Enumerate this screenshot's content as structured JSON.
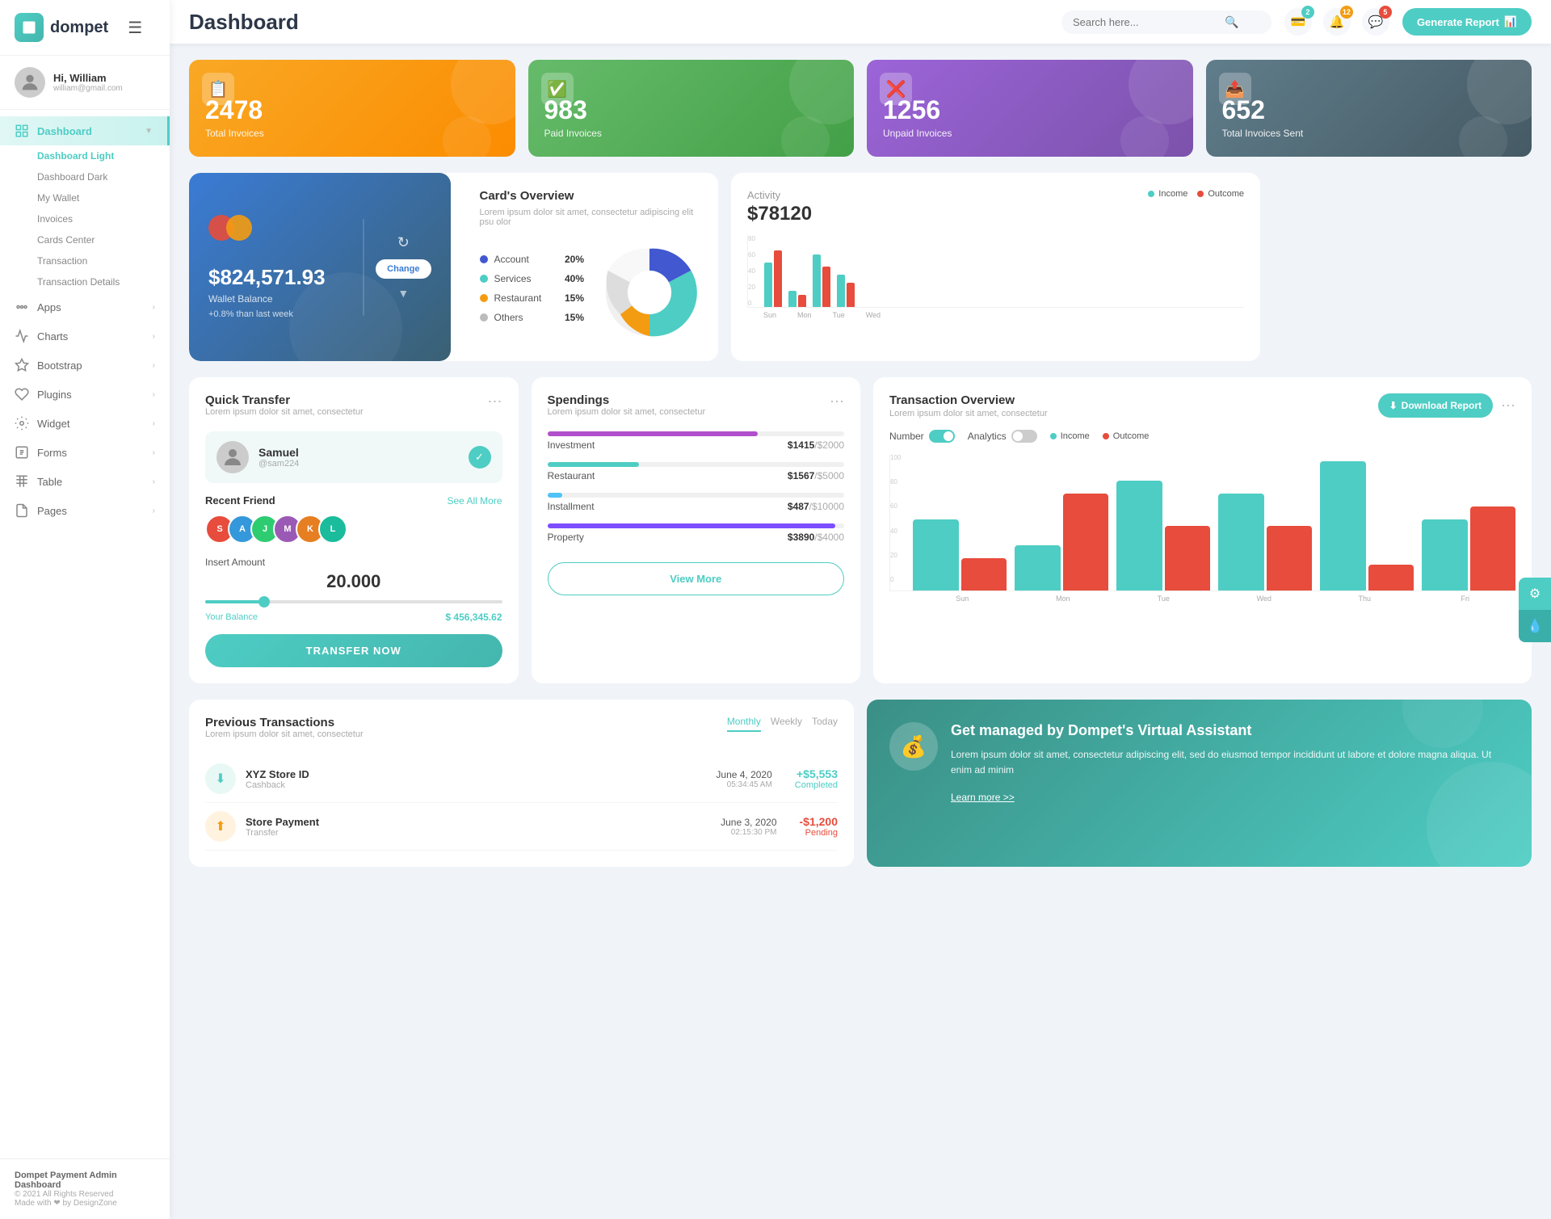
{
  "app": {
    "logo_text": "dompet",
    "page_title": "Dashboard",
    "footer_brand": "Dompet Payment Admin Dashboard",
    "footer_copy": "© 2021 All Rights Reserved",
    "footer_made": "Made with ❤ by DesignZone"
  },
  "topbar": {
    "search_placeholder": "Search here...",
    "badge_wallet": "2",
    "badge_bell": "12",
    "badge_chat": "5",
    "generate_btn": "Generate Report"
  },
  "user": {
    "greeting": "Hi, William",
    "email": "william@gmail.com"
  },
  "nav": {
    "main_item": "Dashboard",
    "sub_items": [
      "Dashboard Light",
      "Dashboard Dark",
      "My Wallet",
      "Invoices",
      "Cards Center",
      "Transaction",
      "Transaction Details"
    ],
    "section_items": [
      {
        "label": "Apps",
        "has_arrow": true
      },
      {
        "label": "Charts",
        "has_arrow": true
      },
      {
        "label": "Bootstrap",
        "has_arrow": true
      },
      {
        "label": "Plugins",
        "has_arrow": true
      },
      {
        "label": "Widget",
        "has_arrow": true
      },
      {
        "label": "Forms",
        "has_arrow": true
      },
      {
        "label": "Table",
        "has_arrow": true
      },
      {
        "label": "Pages",
        "has_arrow": true
      }
    ]
  },
  "stat_cards": [
    {
      "number": "2478",
      "label": "Total Invoices",
      "color": "orange"
    },
    {
      "number": "983",
      "label": "Paid Invoices",
      "color": "green"
    },
    {
      "number": "1256",
      "label": "Unpaid Invoices",
      "color": "purple"
    },
    {
      "number": "652",
      "label": "Total Invoices Sent",
      "color": "blue-gray"
    }
  ],
  "wallet": {
    "amount": "$824,571.93",
    "label": "Wallet Balance",
    "change": "+0.8% than last week",
    "change_btn": "Change"
  },
  "cards_overview": {
    "title": "Card's Overview",
    "description": "Lorem ipsum dolor sit amet, consectetur adipiscing elit psu olor",
    "items": [
      {
        "label": "Account",
        "pct": "20%",
        "color": "#4158d0"
      },
      {
        "label": "Services",
        "pct": "40%",
        "color": "#4ecdc4"
      },
      {
        "label": "Restaurant",
        "pct": "15%",
        "color": "#f39c12"
      },
      {
        "label": "Others",
        "pct": "15%",
        "color": "#bbb"
      }
    ]
  },
  "activity": {
    "title": "Activity",
    "amount": "$78120",
    "income_label": "Income",
    "outcome_label": "Outcome",
    "y_labels": [
      "80",
      "60",
      "40",
      "20",
      "0"
    ],
    "x_labels": [
      "Sun",
      "Mon",
      "Tue",
      "Wed"
    ],
    "bars": [
      {
        "income": 55,
        "outcome": 70
      },
      {
        "income": 20,
        "outcome": 15
      },
      {
        "income": 65,
        "outcome": 50
      },
      {
        "income": 40,
        "outcome": 30
      }
    ]
  },
  "quick_transfer": {
    "title": "Quick Transfer",
    "description": "Lorem ipsum dolor sit amet, consectetur",
    "recipient_name": "Samuel",
    "recipient_handle": "@sam224",
    "recent_friends_label": "Recent Friend",
    "see_all": "See All More",
    "friends": [
      "S",
      "A",
      "J",
      "M",
      "K",
      "L"
    ],
    "amount_label": "Insert Amount",
    "amount_value": "20.000",
    "balance_label": "Your Balance",
    "balance_value": "$ 456,345.62",
    "transfer_btn": "TRANSFER NOW"
  },
  "spendings": {
    "title": "Spendings",
    "description": "Lorem ipsum dolor sit amet, consectetur",
    "items": [
      {
        "name": "Investment",
        "amount": "$1415",
        "total": "/$2000",
        "pct": 71,
        "color": "#b14fcc"
      },
      {
        "name": "Restaurant",
        "amount": "$1567",
        "total": "/$5000",
        "pct": 31,
        "color": "#4ecdc4"
      },
      {
        "name": "Installment",
        "amount": "$487",
        "total": "/$10000",
        "pct": 5,
        "color": "#4fc3f7"
      },
      {
        "name": "Property",
        "amount": "$3890",
        "total": "/$4000",
        "pct": 97,
        "color": "#7c4dff"
      }
    ],
    "view_more_btn": "View More"
  },
  "transaction_overview": {
    "title": "Transaction Overview",
    "description": "Lorem ipsum dolor sit amet, consectetur",
    "download_btn": "Download Report",
    "number_label": "Number",
    "analytics_label": "Analytics",
    "income_label": "Income",
    "outcome_label": "Outcome",
    "y_labels": [
      "100",
      "80",
      "60",
      "40",
      "20",
      "0"
    ],
    "x_labels": [
      "Sun",
      "Mon",
      "Tue",
      "Wed",
      "Thu",
      "Fri"
    ],
    "bars": [
      {
        "income": 55,
        "outcome": 25
      },
      {
        "income": 35,
        "outcome": 75
      },
      {
        "income": 85,
        "outcome": 50
      },
      {
        "income": 75,
        "outcome": 50
      },
      {
        "income": 100,
        "outcome": 20
      },
      {
        "income": 55,
        "outcome": 65
      }
    ]
  },
  "previous_transactions": {
    "title": "Previous Transactions",
    "description": "Lorem ipsum dolor sit amet, consectetur",
    "tabs": [
      "Monthly",
      "Weekly",
      "Today"
    ],
    "active_tab": "Monthly",
    "items": [
      {
        "name": "XYZ Store ID",
        "type": "Cashback",
        "date": "June 4, 2020",
        "time": "05:34:45 AM",
        "amount": "+$5,553",
        "status": "Completed"
      }
    ]
  },
  "virtual_assistant": {
    "title": "Get managed by Dompet's Virtual Assistant",
    "description": "Lorem ipsum dolor sit amet, consectetur adipiscing elit, sed do eiusmod tempor incididunt ut labore et dolore magna aliqua. Ut enim ad minim",
    "learn_more": "Learn more >>"
  }
}
